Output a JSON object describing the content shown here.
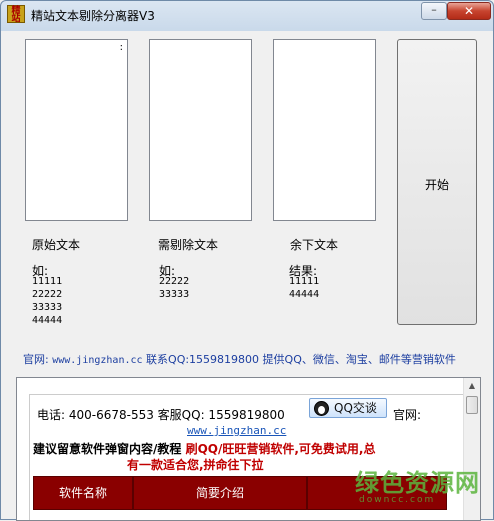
{
  "window": {
    "title": "精站文本剔除分离器V3",
    "minimize_label": "–",
    "close_label": "✕"
  },
  "panes": [
    {
      "label": "原始文本",
      "example_heading": "如:",
      "example_lines": "11111\n22222\n33333\n44444",
      "text": ":"
    },
    {
      "label": "需剔除文本",
      "example_heading": "如:",
      "example_lines": "22222\n33333",
      "text": ""
    },
    {
      "label": "余下文本",
      "example_heading": "结果:",
      "example_lines": "11111\n44444",
      "text": ""
    }
  ],
  "start_button": {
    "label": "开始"
  },
  "info": {
    "prefix": "官网:",
    "url": "www.jingzhan.cc",
    "rest": "联系QQ:1559819800 提供QQ、微信、淘宝、邮件等营销软件"
  },
  "ad": {
    "contact": "电话: 400-6678-553  客服QQ: 1559819800",
    "qq_button": "QQ交谈",
    "website_label": "官网:",
    "link": "www.jingzhan.cc",
    "line1_black": "建议留意软件弹窗内容/教程",
    "line1_red": " 刷QQ/旺旺营销软件,可免费试用,总",
    "line2": "有一款适合您,拼命往下拉",
    "tabs": [
      "软件名称",
      "简要介绍"
    ]
  },
  "watermark": {
    "text": "绿色资源网",
    "sub": "downcc.com"
  }
}
